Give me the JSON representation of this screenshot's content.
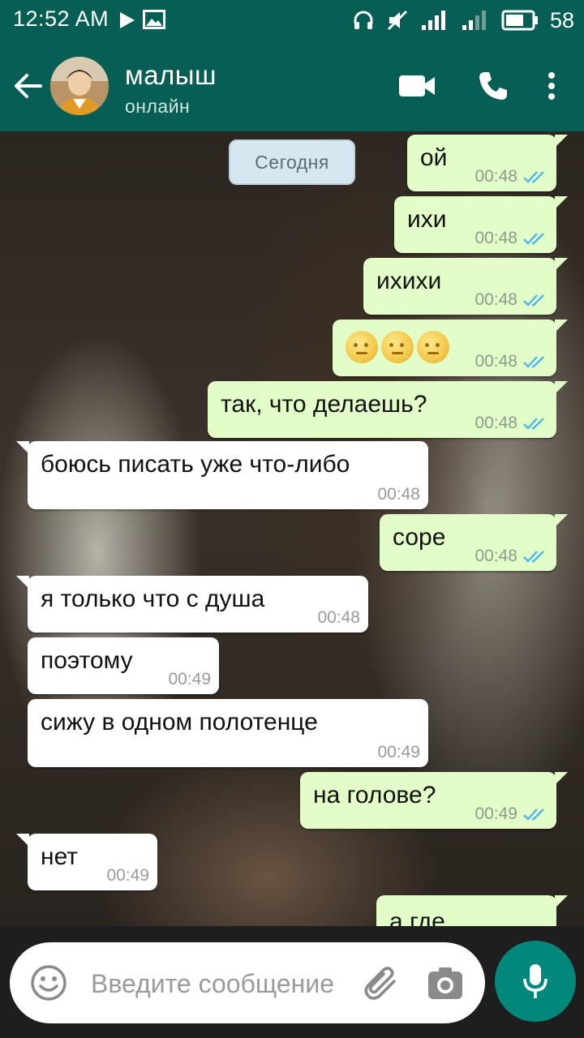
{
  "status_bar": {
    "time": "12:52 AM",
    "battery_pct": "58"
  },
  "header": {
    "contact_name": "малыш",
    "contact_status": "онлайн"
  },
  "chat": {
    "date_label": "Сегодня",
    "messages": [
      {
        "dir": "out",
        "text": "ой",
        "time": "00:48",
        "read": true
      },
      {
        "dir": "out",
        "text": "ихи",
        "time": "00:48",
        "read": true
      },
      {
        "dir": "out",
        "text": "ихихи",
        "time": "00:48",
        "read": true
      },
      {
        "dir": "out",
        "emoji": [
          "full-moon-face",
          "full-moon-face",
          "full-moon-face"
        ],
        "time": "00:48",
        "read": true
      },
      {
        "dir": "out",
        "text": "так, что делаешь?",
        "time": "00:48",
        "read": true
      },
      {
        "dir": "in",
        "text": "боюсь писать уже что-либо",
        "time": "00:48"
      },
      {
        "dir": "out",
        "text": "соре",
        "time": "00:48",
        "read": true
      },
      {
        "dir": "in",
        "text": "я только что с душа",
        "time": "00:48"
      },
      {
        "dir": "in",
        "text": "поэтому",
        "time": "00:49"
      },
      {
        "dir": "in",
        "text": "сижу в одном полотенце",
        "time": "00:49"
      },
      {
        "dir": "out",
        "text": "на голове?",
        "time": "00:49",
        "read": true
      },
      {
        "dir": "in",
        "text": "нет",
        "time": "00:49"
      },
      {
        "dir": "out",
        "text": "а где"
      }
    ]
  },
  "composer": {
    "placeholder": "Введите сообщение"
  },
  "colors": {
    "header": "#075e54",
    "outgoing_bubble": "#e2fdc8",
    "incoming_bubble": "#ffffff",
    "read_ticks": "#4fb6ec",
    "mic_button": "#00897b"
  }
}
